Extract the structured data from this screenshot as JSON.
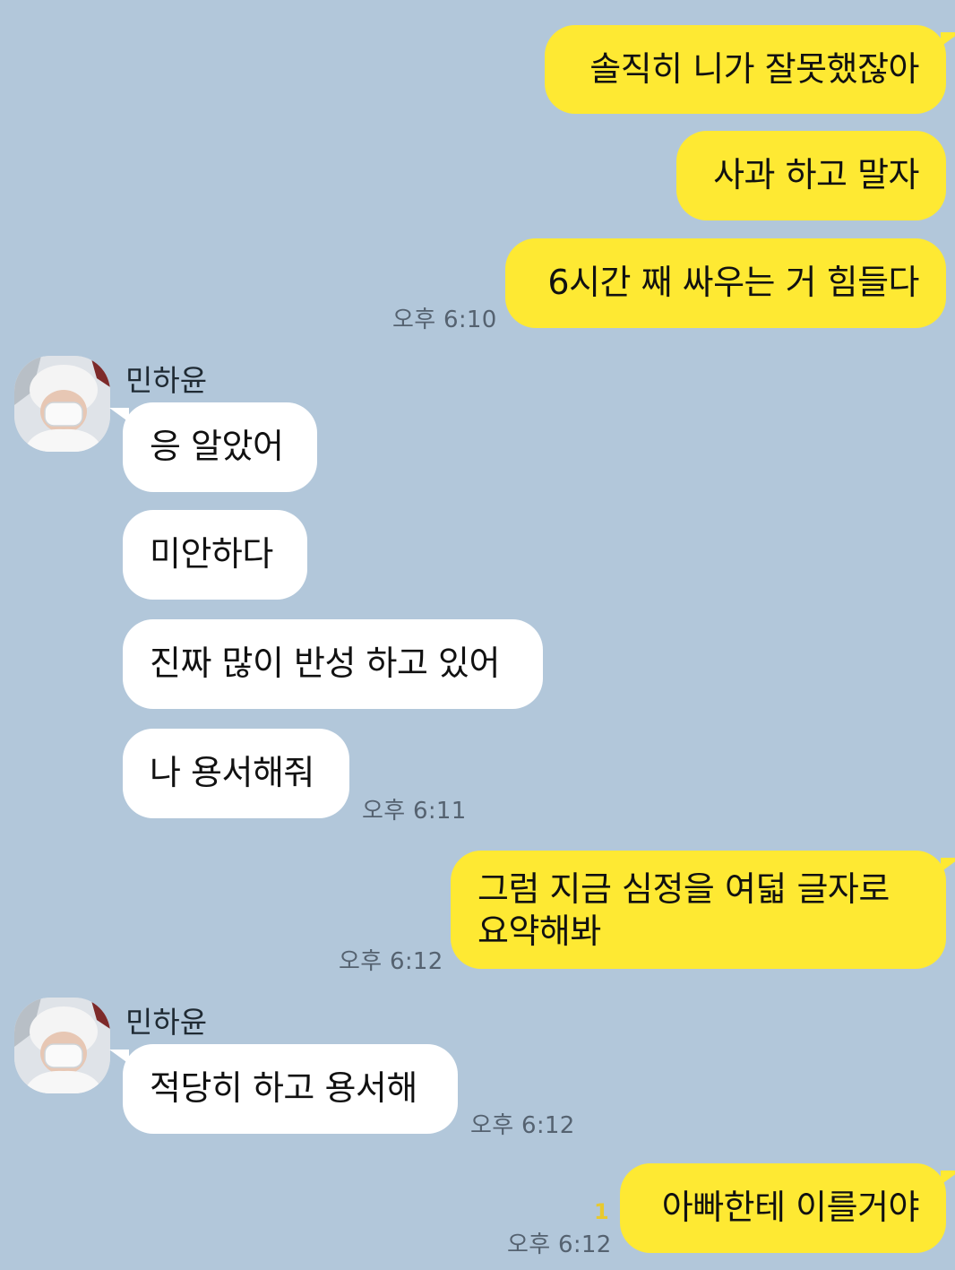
{
  "chat": {
    "contact_name": "민하윤",
    "messages": [
      {
        "from": "me",
        "text": "솔직히 니가 잘못했잖아"
      },
      {
        "from": "me",
        "text": "사과 하고 말자"
      },
      {
        "from": "me",
        "text": "6시간 째 싸우는 거 힘들다",
        "time": "오후 6:10"
      },
      {
        "from": "them",
        "sender": "민하윤",
        "text": "응 알았어"
      },
      {
        "from": "them",
        "text": "미안하다"
      },
      {
        "from": "them",
        "text": "진짜 많이 반성 하고 있어"
      },
      {
        "from": "them",
        "text": "나 용서해줘",
        "time": "오후 6:11"
      },
      {
        "from": "me",
        "text": "그럼 지금 심정을 여덟 글자로 요약해봐",
        "time": "오후 6:12"
      },
      {
        "from": "them",
        "sender": "민하윤",
        "text": "적당히 하고 용서해",
        "time": "오후 6:12"
      },
      {
        "from": "me",
        "text": "아빠한테 이를거야",
        "time": "오후 6:12",
        "unread": "1"
      }
    ]
  },
  "colors": {
    "background": "#b2c7da",
    "my_bubble": "#fee933",
    "their_bubble": "#ffffff",
    "timestamp": "#556270",
    "unread_count": "#e8c92e"
  },
  "icons": {
    "avatar": "profile-photo-white-hat-mask"
  }
}
